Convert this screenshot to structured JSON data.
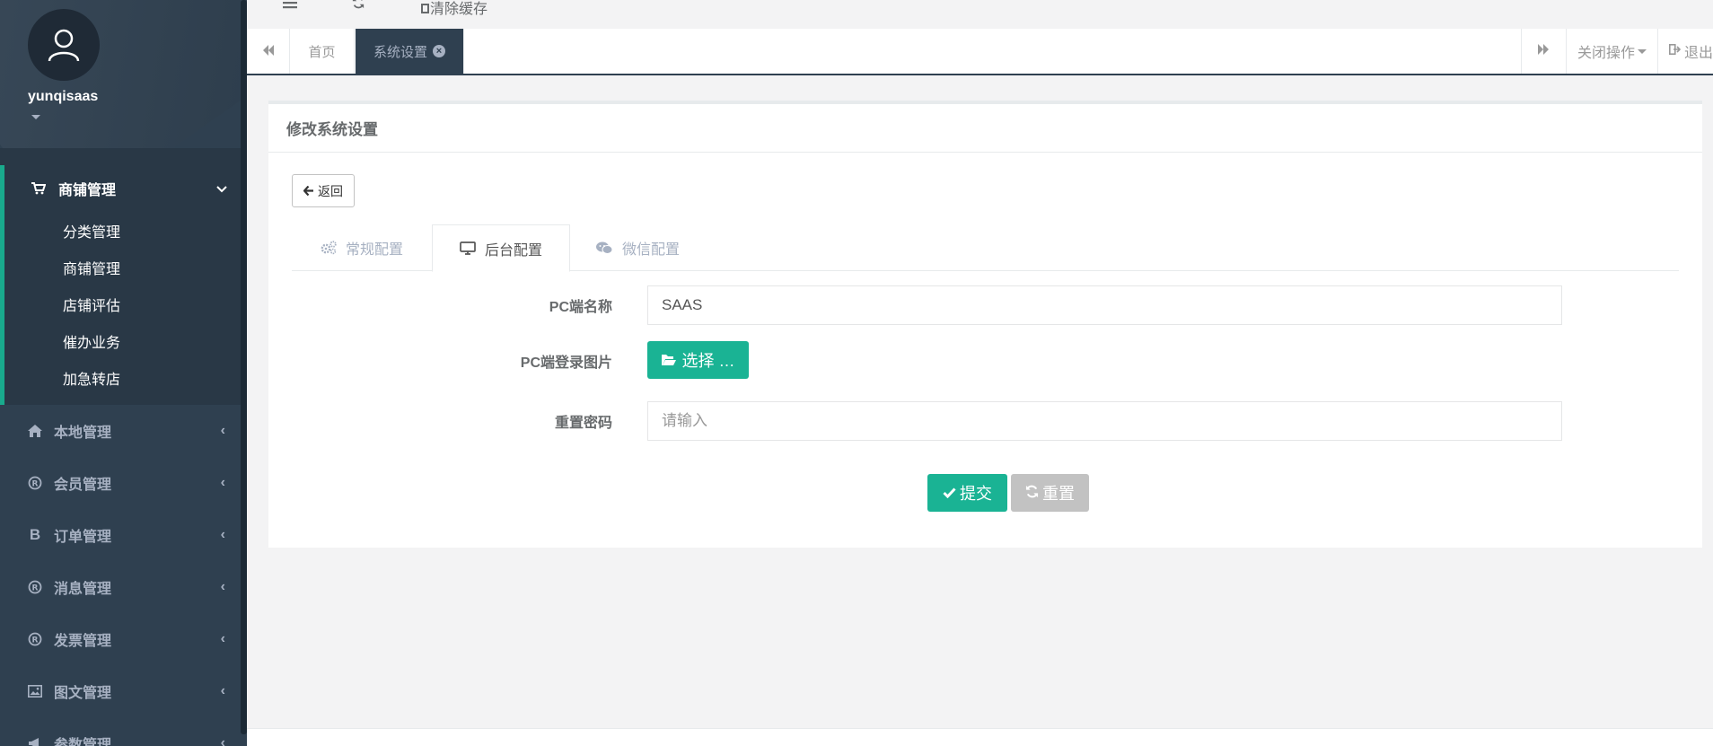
{
  "user": {
    "name": "yunqisaas"
  },
  "sidebar": {
    "active_group": {
      "label": "商铺管理",
      "items": [
        "分类管理",
        "商铺管理",
        "店铺评估",
        "催办业务",
        "加急转店"
      ]
    },
    "groups": [
      {
        "label": "本地管理",
        "icon": "home-icon"
      },
      {
        "label": "会员管理",
        "icon": "registered-icon"
      },
      {
        "label": "订单管理",
        "icon": "bitcoin-b-icon"
      },
      {
        "label": "消息管理",
        "icon": "registered-icon"
      },
      {
        "label": "发票管理",
        "icon": "registered-icon"
      },
      {
        "label": "图文管理",
        "icon": "image-icon"
      },
      {
        "label": "参数管理",
        "icon": "megaphone-icon"
      }
    ]
  },
  "topbar": {
    "clear_cache": "清除缓存"
  },
  "tabs": {
    "home": "首页",
    "active": "系统设置",
    "close_ops": "关闭操作",
    "logout": "退出"
  },
  "panel": {
    "title": "修改系统设置",
    "back_label": "返回",
    "config_tabs": [
      "常规配置",
      "后台配置",
      "微信配置"
    ],
    "active_config_tab": 1,
    "fields": {
      "pc_name_label": "PC端名称",
      "pc_name_value": "SAAS",
      "pc_login_image_label": "PC端登录图片",
      "choose_label": "选择 …",
      "reset_password_label": "重置密码",
      "reset_password_placeholder": "请输入"
    },
    "submit_label": "提交",
    "reset_label": "重置"
  },
  "colors": {
    "sidebar_bg": "#2f4050",
    "accent": "#1ab394",
    "reset_gray": "#c2c2c2"
  }
}
